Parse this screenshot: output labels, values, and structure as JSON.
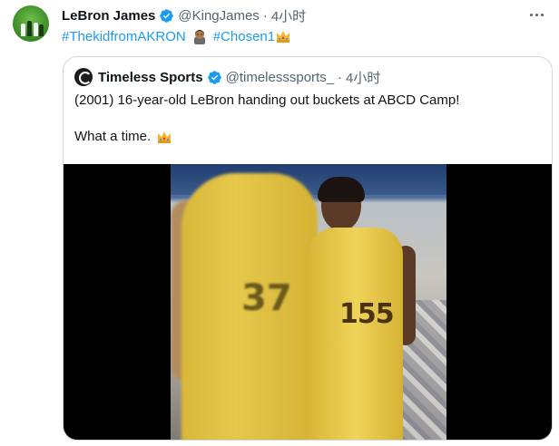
{
  "tweet": {
    "author_name": "LeBron James",
    "handle": "@KingJames",
    "separator": "·",
    "time": "4小时",
    "hashtags": [
      "#ThekidfromAKRON",
      "#Chosen1"
    ],
    "emojis": [
      "person-emoji",
      "crown-emoji"
    ]
  },
  "quote": {
    "author_name": "Timeless Sports",
    "handle": "@timelesssports_",
    "separator": "·",
    "time": "4小时",
    "text_line1": "(2001) 16-year-old LeBron handing out buckets at ABCD Camp!",
    "text_line2": "What a time.",
    "media": {
      "jersey_left": "37",
      "jersey_right": "155"
    }
  },
  "colors": {
    "link": "#1d9bf0",
    "verified": "#1d9bf0",
    "muted": "#536471",
    "border": "#cfd9de"
  }
}
